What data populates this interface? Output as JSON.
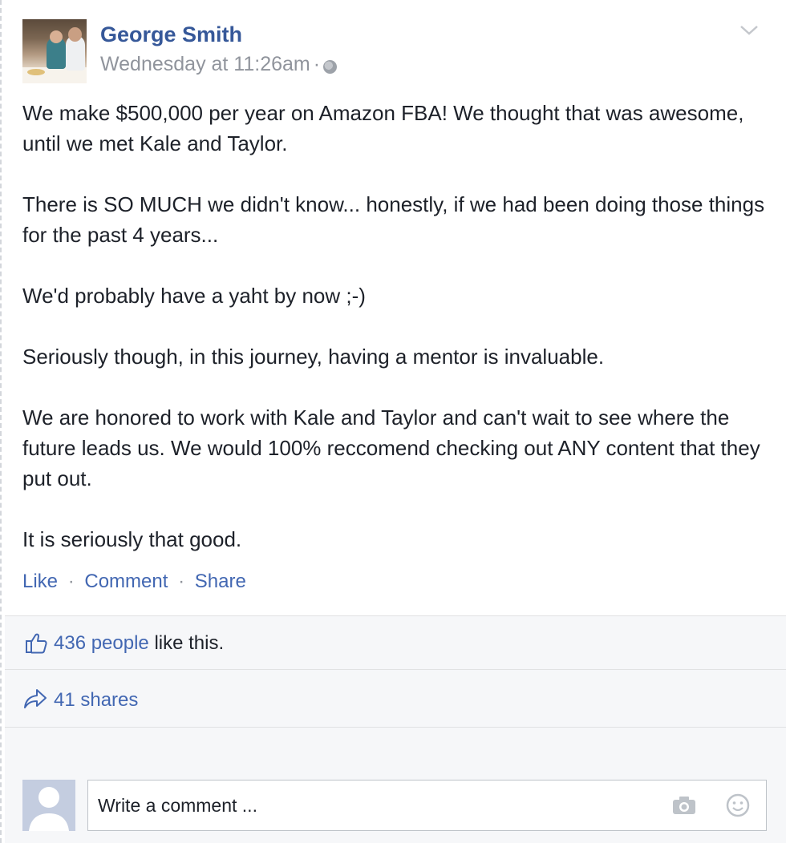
{
  "post": {
    "author": "George Smith",
    "timestamp": "Wednesday at 11:26am",
    "separator": "·",
    "privacy_icon": "globe-icon",
    "menu_icon": "chevron-down-icon",
    "paragraphs": [
      "We make $500,000 per year on Amazon FBA! We thought that was awesome, until we met Kale and Taylor.",
      "There is SO MUCH we didn't know... honestly, if we had been doing those things for the past 4 years...",
      "We'd probably have a yaht by now ;-)",
      "Seriously though, in this journey, having a mentor is invaluable.",
      "We are honored to work with Kale and Taylor and can't wait to see where the future leads us. We would 100% reccomend checking out ANY content that they put out.",
      "It is seriously that good."
    ],
    "actions": {
      "like": "Like",
      "comment": "Comment",
      "share": "Share",
      "separator": "·"
    }
  },
  "engagement": {
    "likes_link": "436 people",
    "likes_suffix": " like this.",
    "shares": "41 shares"
  },
  "comment_composer": {
    "placeholder": "Write a comment ..."
  },
  "colors": {
    "link": "#4267b2",
    "author": "#365899",
    "meta": "#90949c",
    "ufi_background": "#f6f7f9"
  }
}
